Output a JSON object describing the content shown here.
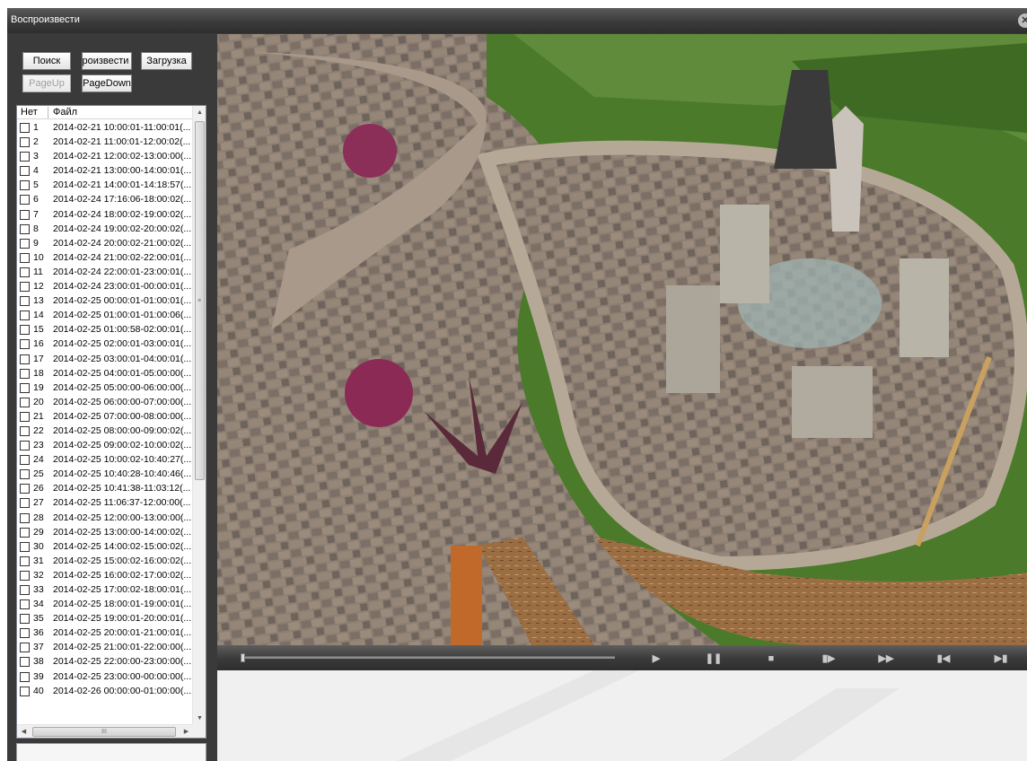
{
  "window": {
    "title": "Воспроизвести",
    "close_glyph": "✕"
  },
  "toolbar": {
    "search_label": "Поиск",
    "play_label": "Воспроизвести",
    "download_label": "Загрузка",
    "pageup_label": "PageUp",
    "pagedown_label": "PageDown"
  },
  "list": {
    "columns": [
      "Нет",
      "Файл"
    ],
    "rows": [
      {
        "num": "1",
        "file": "2014-02-21 10:00:01-11:00:01(..."
      },
      {
        "num": "2",
        "file": "2014-02-21 11:00:01-12:00:02(..."
      },
      {
        "num": "3",
        "file": "2014-02-21 12:00:02-13:00:00(..."
      },
      {
        "num": "4",
        "file": "2014-02-21 13:00:00-14:00:01(..."
      },
      {
        "num": "5",
        "file": "2014-02-21 14:00:01-14:18:57(..."
      },
      {
        "num": "6",
        "file": "2014-02-24 17:16:06-18:00:02(..."
      },
      {
        "num": "7",
        "file": "2014-02-24 18:00:02-19:00:02(..."
      },
      {
        "num": "8",
        "file": "2014-02-24 19:00:02-20:00:02(..."
      },
      {
        "num": "9",
        "file": "2014-02-24 20:00:02-21:00:02(..."
      },
      {
        "num": "10",
        "file": "2014-02-24 21:00:02-22:00:01(..."
      },
      {
        "num": "11",
        "file": "2014-02-24 22:00:01-23:00:01(..."
      },
      {
        "num": "12",
        "file": "2014-02-24 23:00:01-00:00:01(..."
      },
      {
        "num": "13",
        "file": "2014-02-25 00:00:01-01:00:01(..."
      },
      {
        "num": "14",
        "file": "2014-02-25 01:00:01-01:00:06(..."
      },
      {
        "num": "15",
        "file": "2014-02-25 01:00:58-02:00:01(..."
      },
      {
        "num": "16",
        "file": "2014-02-25 02:00:01-03:00:01(..."
      },
      {
        "num": "17",
        "file": "2014-02-25 03:00:01-04:00:01(..."
      },
      {
        "num": "18",
        "file": "2014-02-25 04:00:01-05:00:00(..."
      },
      {
        "num": "19",
        "file": "2014-02-25 05:00:00-06:00:00(..."
      },
      {
        "num": "20",
        "file": "2014-02-25 06:00:00-07:00:00(..."
      },
      {
        "num": "21",
        "file": "2014-02-25 07:00:00-08:00:00(..."
      },
      {
        "num": "22",
        "file": "2014-02-25 08:00:00-09:00:02(..."
      },
      {
        "num": "23",
        "file": "2014-02-25 09:00:02-10:00:02(..."
      },
      {
        "num": "24",
        "file": "2014-02-25 10:00:02-10:40:27(..."
      },
      {
        "num": "25",
        "file": "2014-02-25 10:40:28-10:40:46(..."
      },
      {
        "num": "26",
        "file": "2014-02-25 10:41:38-11:03:12(..."
      },
      {
        "num": "27",
        "file": "2014-02-25 11:06:37-12:00:00(..."
      },
      {
        "num": "28",
        "file": "2014-02-25 12:00:00-13:00:00(..."
      },
      {
        "num": "29",
        "file": "2014-02-25 13:00:00-14:00:02(..."
      },
      {
        "num": "30",
        "file": "2014-02-25 14:00:02-15:00:02(..."
      },
      {
        "num": "31",
        "file": "2014-02-25 15:00:02-16:00:02(..."
      },
      {
        "num": "32",
        "file": "2014-02-25 16:00:02-17:00:02(..."
      },
      {
        "num": "33",
        "file": "2014-02-25 17:00:02-18:00:01(..."
      },
      {
        "num": "34",
        "file": "2014-02-25 18:00:01-19:00:01(..."
      },
      {
        "num": "35",
        "file": "2014-02-25 19:00:01-20:00:01(..."
      },
      {
        "num": "36",
        "file": "2014-02-25 20:00:01-21:00:01(..."
      },
      {
        "num": "37",
        "file": "2014-02-25 21:00:01-22:00:00(..."
      },
      {
        "num": "38",
        "file": "2014-02-25 22:00:00-23:00:00(..."
      },
      {
        "num": "39",
        "file": "2014-02-25 23:00:00-00:00:00(..."
      },
      {
        "num": "40",
        "file": "2014-02-26 00:00:00-01:00:00(..."
      }
    ]
  },
  "scrollbar": {
    "up": "▲",
    "down": "▼",
    "left": "◀",
    "right": "▶",
    "grip": "≡",
    "hgrip": "III"
  },
  "player": {
    "position_fraction": 0.0,
    "controls": [
      {
        "name": "play-button",
        "icon": "play-icon",
        "glyph": "▶"
      },
      {
        "name": "pause-button",
        "icon": "pause-icon",
        "glyph": "❚❚"
      },
      {
        "name": "stop-button",
        "icon": "stop-icon",
        "glyph": "■"
      },
      {
        "name": "step-frame-button",
        "icon": "step-forward-icon",
        "glyph": "▮▶"
      },
      {
        "name": "fast-forward-button",
        "icon": "fast-forward-icon",
        "glyph": "▶▶"
      },
      {
        "name": "previous-button",
        "icon": "skip-back-icon",
        "glyph": "▮◀"
      },
      {
        "name": "next-button",
        "icon": "skip-forward-icon",
        "glyph": "▶▮"
      }
    ]
  },
  "colors": {
    "window_bg": "#3a3a3a",
    "titlebar": "#3b3b3b",
    "grass": "#4e8a2a",
    "paver": "#8a7b6e"
  }
}
